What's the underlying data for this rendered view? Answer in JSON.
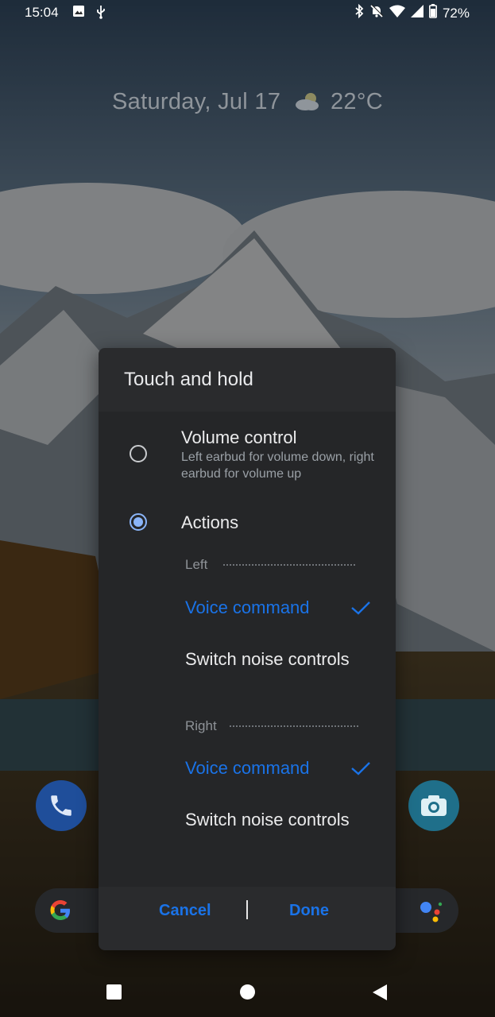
{
  "status_bar": {
    "time": "15:04",
    "battery_percent": "72%",
    "left_icons": [
      "image-icon",
      "usb-icon"
    ],
    "right_icons": [
      "bluetooth-icon",
      "notifications-off-icon",
      "wifi-icon",
      "cell-signal-icon",
      "battery-icon"
    ]
  },
  "lockscreen": {
    "date": "Saturday, Jul 17",
    "temperature": "22°C",
    "weather_icon": "partly-cloudy-icon"
  },
  "dialog": {
    "title": "Touch and hold",
    "options": [
      {
        "title": "Volume control",
        "description": "Left earbud for volume down, right earbud for volume up",
        "selected": false
      },
      {
        "title": "Actions",
        "selected": true
      }
    ],
    "left_section": {
      "label": "Left",
      "choices": [
        {
          "label": "Voice command",
          "selected": true
        },
        {
          "label": "Switch noise controls",
          "selected": false
        }
      ]
    },
    "right_section": {
      "label": "Right",
      "choices": [
        {
          "label": "Voice command",
          "selected": true
        },
        {
          "label": "Switch noise controls",
          "selected": false
        }
      ]
    },
    "cancel_label": "Cancel",
    "done_label": "Done"
  },
  "colors": {
    "accent": "#1a73e8",
    "radio_checked": "#8ab4f8",
    "dialog_bg": "#2a2b2d"
  }
}
